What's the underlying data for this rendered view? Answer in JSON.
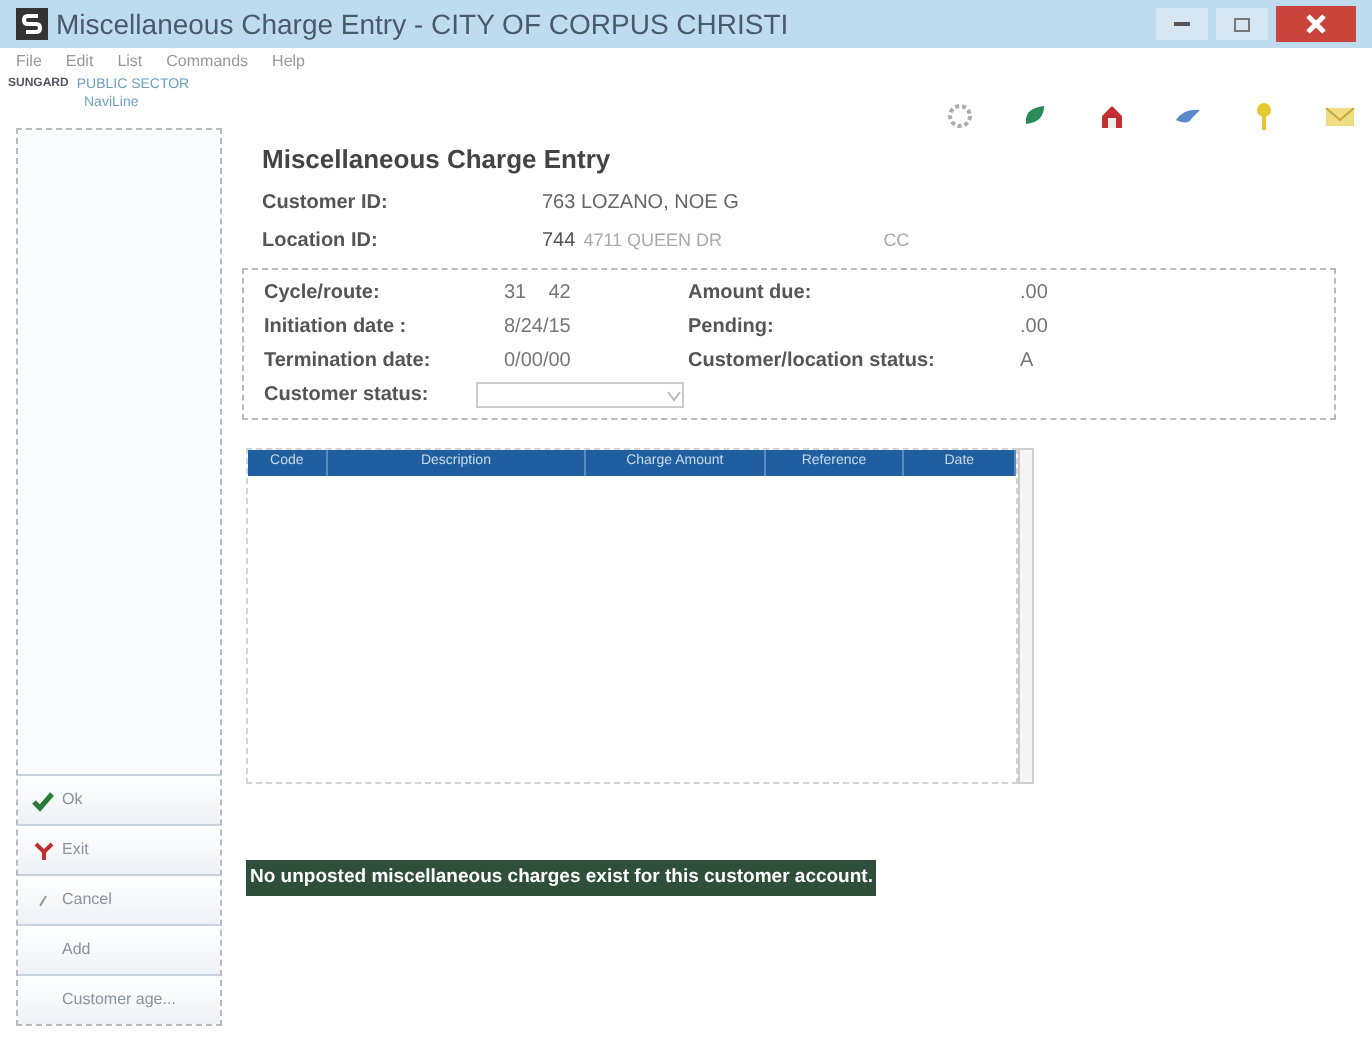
{
  "window": {
    "title": "Miscellaneous Charge Entry - CITY OF CORPUS CHRISTI"
  },
  "menu": [
    "File",
    "Edit",
    "List",
    "Commands",
    "Help"
  ],
  "logo": {
    "company": "SUNGARD",
    "division": "PUBLIC SECTOR",
    "product": "NaviLine"
  },
  "sidebar": {
    "buttons": [
      {
        "label": "Ok",
        "kind": "ok"
      },
      {
        "label": "Exit",
        "kind": "exit"
      },
      {
        "label": "Cancel",
        "kind": "cancel"
      },
      {
        "label": "Add",
        "kind": "plain"
      },
      {
        "label": "Customer age...",
        "kind": "plain"
      }
    ]
  },
  "heading": "Miscellaneous Charge Entry",
  "customer": {
    "label": "Customer ID:",
    "value": "763 LOZANO, NOE G"
  },
  "location": {
    "label": "Location ID:",
    "id": "744",
    "address": "4711 QUEEN DR",
    "suffix": "CC"
  },
  "details": [
    {
      "label": "Cycle/route:",
      "value": "31    42",
      "label2": "Amount due:",
      "value2": ".00"
    },
    {
      "label": "Initiation date :",
      "value": "8/24/15",
      "label2": "Pending:",
      "value2": ".00"
    },
    {
      "label": "Termination date:",
      "value": "0/00/00",
      "label2": "Customer/location status:",
      "value2": "A"
    }
  ],
  "customer_status": {
    "label": "Customer status:"
  },
  "table": {
    "columns": [
      "Code",
      "Description",
      "Charge Amount",
      "Reference",
      "Date"
    ]
  },
  "message": "No unposted miscellaneous charges exist for this customer account."
}
